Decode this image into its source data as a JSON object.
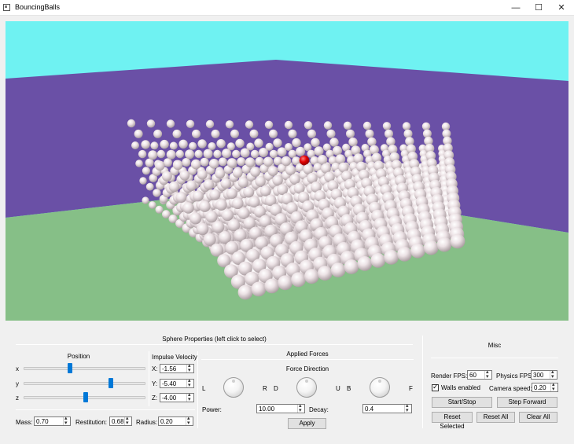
{
  "window": {
    "title": "BouncingBalls",
    "minimize": "—",
    "maximize": "☐",
    "close": "✕"
  },
  "scene": {
    "sky_color": "#6ff2f2",
    "wall_color": "#6a50a6",
    "floor_color": "#86bf87",
    "ball_color": "#efe4e7",
    "selected_ball_color": "#e00000"
  },
  "sphere_properties": {
    "title": "Sphere Properties (left click to select)",
    "position": {
      "title": "Position",
      "axes": [
        {
          "label": "x",
          "level": 0.37
        },
        {
          "label": "y",
          "level": 0.72
        },
        {
          "label": "z",
          "level": 0.5
        }
      ]
    },
    "impulse_velocity": {
      "title": "Impulse Velocity",
      "fields": [
        {
          "label": "X:",
          "value": "-1.56"
        },
        {
          "label": "Y:",
          "value": "-5.40"
        },
        {
          "label": "Z:",
          "value": "-4.00"
        }
      ]
    },
    "mass": {
      "label": "Mass:",
      "value": "0.70"
    },
    "restitution": {
      "label": "Restitution:",
      "value": "0.68"
    },
    "radius": {
      "label": "Radius:",
      "value": "0.20"
    }
  },
  "applied_forces": {
    "title": "Applied Forces",
    "direction_title": "Force Direction",
    "dials": [
      {
        "left": "L",
        "right": "R"
      },
      {
        "left": "D",
        "right": "U"
      },
      {
        "left": "B",
        "right": "F"
      }
    ],
    "power": {
      "label": "Power:",
      "value": "10.00"
    },
    "decay": {
      "label": "Decay:",
      "value": "0.4"
    },
    "apply_label": "Apply"
  },
  "misc": {
    "title": "Misc",
    "render_fps": {
      "label": "Render FPS:",
      "value": "60"
    },
    "physics_fps": {
      "label": "Physics FPS:",
      "value": "300"
    },
    "walls_enabled": {
      "label": "Walls enabled",
      "checked": true
    },
    "camera_speed": {
      "label": "Camera speed:",
      "value": "0.20"
    },
    "start_stop_label": "Start/Stop",
    "step_forward_label": "Step Forward",
    "reset_selected_label": "Reset Selected",
    "reset_all_label": "Reset All",
    "clear_all_label": "Clear All"
  }
}
